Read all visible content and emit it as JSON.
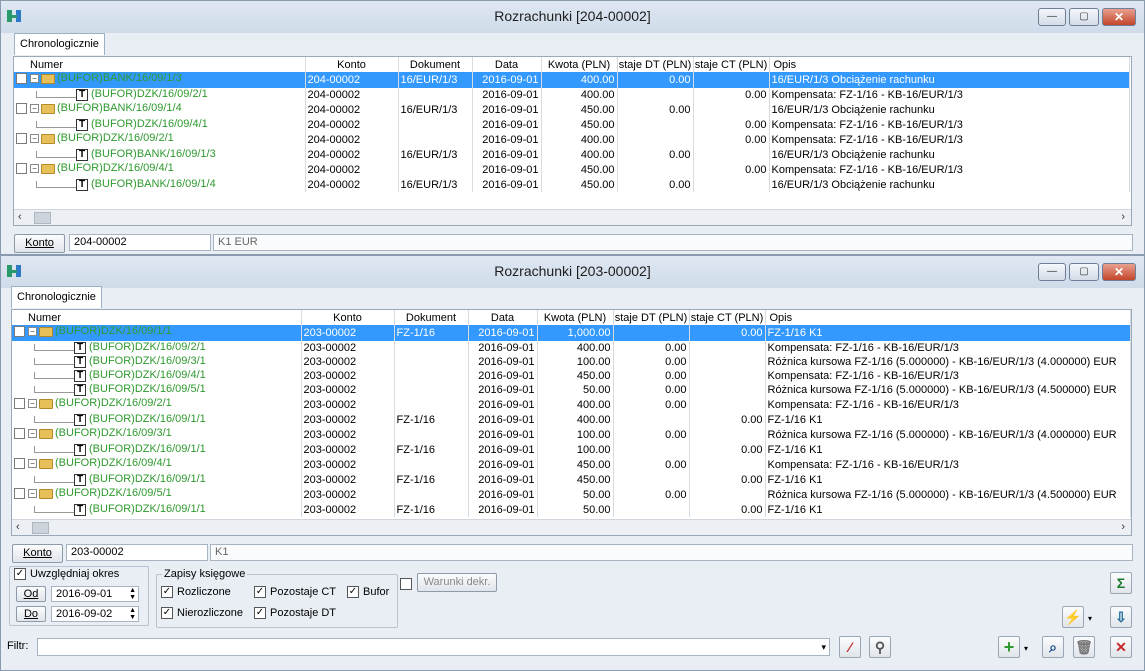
{
  "window1": {
    "title": "Rozrachunki [204-00002]",
    "tab": "Chronologicznie",
    "konto_button": "Konto",
    "konto_value": "204-00002",
    "konto_name": "K1 EUR",
    "columns": [
      "Numer",
      "Konto",
      "Dokument",
      "Data",
      "Kwota (PLN)",
      "staje DT (PLN)",
      "staje CT (PLN)",
      "Opis"
    ],
    "rows": [
      {
        "lvl": 0,
        "numer": "(BUFOR)BANK/16/09/1/3",
        "konto": "204-00002",
        "dokument": "16/EUR/1/3",
        "data": "2016-09-01",
        "kwota": "400.00",
        "dt": "0.00",
        "ct": "",
        "opis": "16/EUR/1/3 Obciążenie rachunku",
        "sel": true
      },
      {
        "lvl": 1,
        "numer": "(BUFOR)DZK/16/09/2/1",
        "konto": "204-00002",
        "dokument": "",
        "data": "2016-09-01",
        "kwota": "400.00",
        "dt": "",
        "ct": "0.00",
        "opis": "Kompensata: FZ-1/16 - KB-16/EUR/1/3"
      },
      {
        "lvl": 0,
        "numer": "(BUFOR)BANK/16/09/1/4",
        "konto": "204-00002",
        "dokument": "16/EUR/1/3",
        "data": "2016-09-01",
        "kwota": "450.00",
        "dt": "0.00",
        "ct": "",
        "opis": "16/EUR/1/3 Obciążenie rachunku"
      },
      {
        "lvl": 1,
        "numer": "(BUFOR)DZK/16/09/4/1",
        "konto": "204-00002",
        "dokument": "",
        "data": "2016-09-01",
        "kwota": "450.00",
        "dt": "",
        "ct": "0.00",
        "opis": "Kompensata: FZ-1/16 - KB-16/EUR/1/3"
      },
      {
        "lvl": 0,
        "numer": "(BUFOR)DZK/16/09/2/1",
        "konto": "204-00002",
        "dokument": "",
        "data": "2016-09-01",
        "kwota": "400.00",
        "dt": "",
        "ct": "0.00",
        "opis": "Kompensata: FZ-1/16 - KB-16/EUR/1/3"
      },
      {
        "lvl": 1,
        "numer": "(BUFOR)BANK/16/09/1/3",
        "konto": "204-00002",
        "dokument": "16/EUR/1/3",
        "data": "2016-09-01",
        "kwota": "400.00",
        "dt": "0.00",
        "ct": "",
        "opis": "16/EUR/1/3 Obciążenie rachunku"
      },
      {
        "lvl": 0,
        "numer": "(BUFOR)DZK/16/09/4/1",
        "konto": "204-00002",
        "dokument": "",
        "data": "2016-09-01",
        "kwota": "450.00",
        "dt": "",
        "ct": "0.00",
        "opis": "Kompensata: FZ-1/16 - KB-16/EUR/1/3"
      },
      {
        "lvl": 1,
        "numer": "(BUFOR)BANK/16/09/1/4",
        "konto": "204-00002",
        "dokument": "16/EUR/1/3",
        "data": "2016-09-01",
        "kwota": "450.00",
        "dt": "0.00",
        "ct": "",
        "opis": "16/EUR/1/3 Obciążenie rachunku"
      }
    ]
  },
  "window2": {
    "title": "Rozrachunki [203-00002]",
    "tab": "Chronologicznie",
    "konto_button": "Konto",
    "konto_value": "203-00002",
    "konto_name": "K1",
    "columns": [
      "Numer",
      "Konto",
      "Dokument",
      "Data",
      "Kwota (PLN)",
      "staje DT (PLN)",
      "staje CT (PLN)",
      "Opis"
    ],
    "rows": [
      {
        "lvl": 0,
        "numer": "(BUFOR)DZK/16/09/1/1",
        "konto": "203-00002",
        "dokument": "FZ-1/16",
        "data": "2016-09-01",
        "kwota": "1,000.00",
        "dt": "",
        "ct": "0.00",
        "opis": "FZ-1/16 K1",
        "sel": true
      },
      {
        "lvl": 1,
        "numer": "(BUFOR)DZK/16/09/2/1",
        "konto": "203-00002",
        "dokument": "",
        "data": "2016-09-01",
        "kwota": "400.00",
        "dt": "0.00",
        "ct": "",
        "opis": "Kompensata: FZ-1/16 - KB-16/EUR/1/3"
      },
      {
        "lvl": 1,
        "numer": "(BUFOR)DZK/16/09/3/1",
        "konto": "203-00002",
        "dokument": "",
        "data": "2016-09-01",
        "kwota": "100.00",
        "dt": "0.00",
        "ct": "",
        "opis": "Różnica kursowa FZ-1/16 (5.000000) - KB-16/EUR/1/3 (4.000000) EUR"
      },
      {
        "lvl": 1,
        "numer": "(BUFOR)DZK/16/09/4/1",
        "konto": "203-00002",
        "dokument": "",
        "data": "2016-09-01",
        "kwota": "450.00",
        "dt": "0.00",
        "ct": "",
        "opis": "Kompensata: FZ-1/16 - KB-16/EUR/1/3"
      },
      {
        "lvl": 1,
        "numer": "(BUFOR)DZK/16/09/5/1",
        "konto": "203-00002",
        "dokument": "",
        "data": "2016-09-01",
        "kwota": "50.00",
        "dt": "0.00",
        "ct": "",
        "opis": "Różnica kursowa FZ-1/16 (5.000000) - KB-16/EUR/1/3 (4.500000) EUR"
      },
      {
        "lvl": 0,
        "numer": "(BUFOR)DZK/16/09/2/1",
        "konto": "203-00002",
        "dokument": "",
        "data": "2016-09-01",
        "kwota": "400.00",
        "dt": "0.00",
        "ct": "",
        "opis": "Kompensata: FZ-1/16 - KB-16/EUR/1/3"
      },
      {
        "lvl": 1,
        "numer": "(BUFOR)DZK/16/09/1/1",
        "konto": "203-00002",
        "dokument": "FZ-1/16",
        "data": "2016-09-01",
        "kwota": "400.00",
        "dt": "",
        "ct": "0.00",
        "opis": "FZ-1/16 K1"
      },
      {
        "lvl": 0,
        "numer": "(BUFOR)DZK/16/09/3/1",
        "konto": "203-00002",
        "dokument": "",
        "data": "2016-09-01",
        "kwota": "100.00",
        "dt": "0.00",
        "ct": "",
        "opis": "Różnica kursowa FZ-1/16 (5.000000) - KB-16/EUR/1/3 (4.000000) EUR"
      },
      {
        "lvl": 1,
        "numer": "(BUFOR)DZK/16/09/1/1",
        "konto": "203-00002",
        "dokument": "FZ-1/16",
        "data": "2016-09-01",
        "kwota": "100.00",
        "dt": "",
        "ct": "0.00",
        "opis": "FZ-1/16 K1"
      },
      {
        "lvl": 0,
        "numer": "(BUFOR)DZK/16/09/4/1",
        "konto": "203-00002",
        "dokument": "",
        "data": "2016-09-01",
        "kwota": "450.00",
        "dt": "0.00",
        "ct": "",
        "opis": "Kompensata: FZ-1/16 - KB-16/EUR/1/3"
      },
      {
        "lvl": 1,
        "numer": "(BUFOR)DZK/16/09/1/1",
        "konto": "203-00002",
        "dokument": "FZ-1/16",
        "data": "2016-09-01",
        "kwota": "450.00",
        "dt": "",
        "ct": "0.00",
        "opis": "FZ-1/16 K1"
      },
      {
        "lvl": 0,
        "numer": "(BUFOR)DZK/16/09/5/1",
        "konto": "203-00002",
        "dokument": "",
        "data": "2016-09-01",
        "kwota": "50.00",
        "dt": "0.00",
        "ct": "",
        "opis": "Różnica kursowa FZ-1/16 (5.000000) - KB-16/EUR/1/3 (4.500000) EUR"
      },
      {
        "lvl": 1,
        "numer": "(BUFOR)DZK/16/09/1/1",
        "konto": "203-00002",
        "dokument": "FZ-1/16",
        "data": "2016-09-01",
        "kwota": "50.00",
        "dt": "",
        "ct": "0.00",
        "opis": "FZ-1/16 K1"
      }
    ]
  },
  "filters": {
    "uwzgledniaj": "Uwzględniaj okres",
    "od_label": "Od",
    "od_value": "2016-09-01",
    "do_label": "Do",
    "do_value": "2016-09-02",
    "zapisy_title": "Zapisy księgowe",
    "rozliczone": "Rozliczone",
    "nierozliczone": "Nierozliczone",
    "pozostaje_ct": "Pozostaje CT",
    "pozostaje_dt": "Pozostaje DT",
    "bufor": "Bufor",
    "warunki": "Warunki dekr.",
    "filtr_label": "Filtr:",
    "filtr_value": ""
  }
}
